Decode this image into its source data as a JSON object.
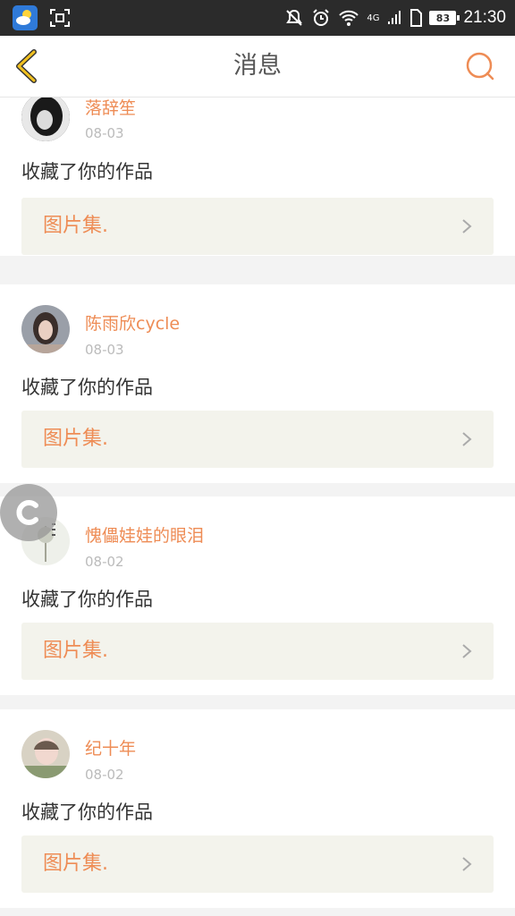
{
  "status_bar": {
    "network": "4G",
    "battery": "83",
    "time": "21:30"
  },
  "header": {
    "title": "消息"
  },
  "notifications": [
    {
      "username": "落辞笙",
      "date": "08-03",
      "action": "收藏了你的作品",
      "work_title": "图片集."
    },
    {
      "username": "陈雨欣cycle",
      "date": "08-03",
      "action": "收藏了你的作品",
      "work_title": "图片集."
    },
    {
      "username": "愧儡娃娃的眼泪",
      "date": "08-02",
      "action": "收藏了你的作品",
      "work_title": "图片集."
    },
    {
      "username": "纪十年",
      "date": "08-02",
      "action": "收藏了你的作品",
      "work_title": "图片集."
    }
  ],
  "floating_button": {
    "label": "C"
  },
  "colors": {
    "accent": "#ee8c55",
    "status_bar": "#2b2b2b",
    "link_bg": "#f3f3ec",
    "back_arrow": "#f0c020"
  }
}
